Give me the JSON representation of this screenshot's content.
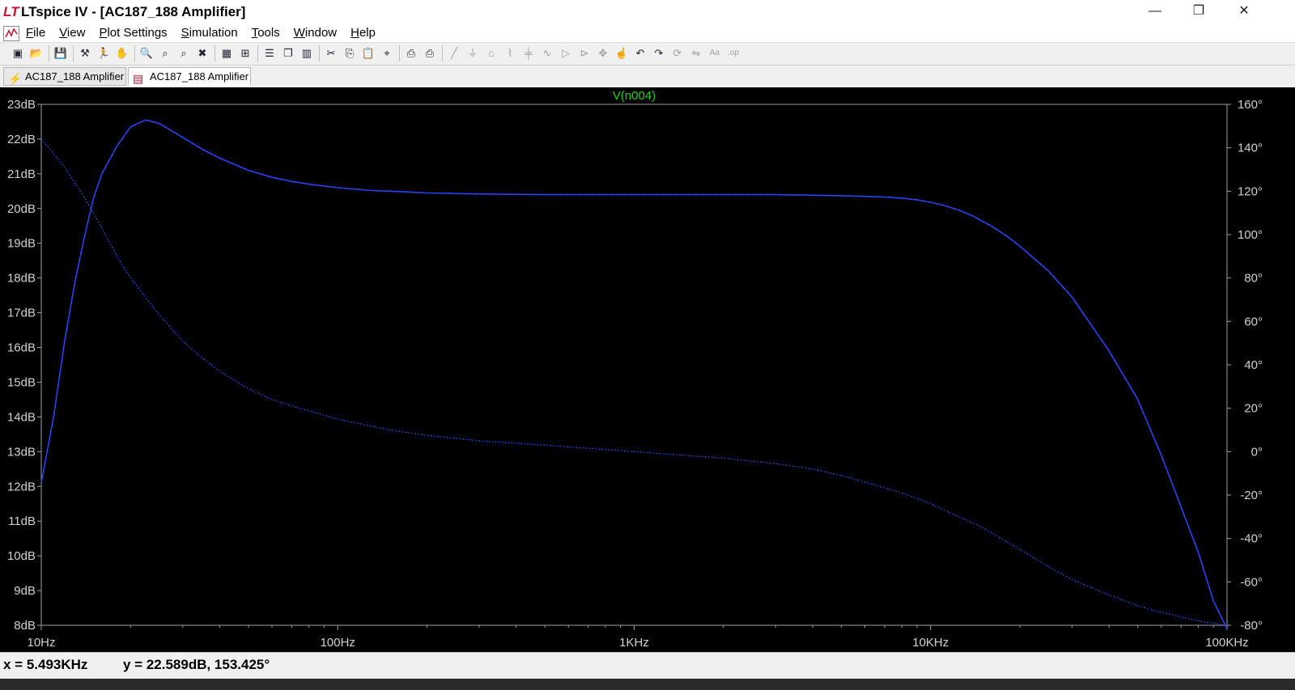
{
  "window": {
    "title": "LTspice IV - [AC187_188 Amplifier]",
    "logo_glyph": "LT",
    "minimize": "—",
    "restore": "❐",
    "close": "✕"
  },
  "menu": {
    "items": [
      {
        "label": "File",
        "u": "F",
        "rest": "ile"
      },
      {
        "label": "View",
        "u": "V",
        "rest": "iew"
      },
      {
        "label": "Plot Settings",
        "u": "P",
        "rest": "lot Settings"
      },
      {
        "label": "Simulation",
        "u": "S",
        "rest": "imulation"
      },
      {
        "label": "Tools",
        "u": "T",
        "rest": "ools"
      },
      {
        "label": "Window",
        "u": "W",
        "rest": "indow"
      },
      {
        "label": "Help",
        "u": "H",
        "rest": "elp"
      }
    ],
    "mdi_min": "_",
    "mdi_restore": "🗗",
    "mdi_close": "✕"
  },
  "toolbar": {
    "icons": [
      "new-schematic-icon",
      "open-icon",
      "save-icon",
      "control-panel-icon",
      "run-icon",
      "pan-hand-icon",
      "zoom-in-icon",
      "zoom-area-icon",
      "zoom-out-icon",
      "zoom-cancel-icon",
      "autorange-icon",
      "zoom-extents-icon",
      "tile-horizontal-icon",
      "cascade-icon",
      "tile-vertical-icon",
      "cut-icon",
      "copy-icon",
      "paste-icon",
      "find-icon",
      "print-preview-icon",
      "print-icon",
      "wire-icon",
      "ground-icon",
      "label-net-icon",
      "resistor-icon",
      "capacitor-icon",
      "inductor-icon",
      "diode-icon",
      "component-icon",
      "move-icon",
      "drag-icon",
      "undo-icon",
      "redo-icon",
      "rotate-icon",
      "mirror-icon",
      "text-icon",
      "spice-directive-icon"
    ]
  },
  "tabs": [
    {
      "label": "AC187_188 Amplifier",
      "kind": "schematic",
      "active": false
    },
    {
      "label": "AC187_188 Amplifier",
      "kind": "waveform",
      "active": true
    }
  ],
  "colors": {
    "plot_bg": "#000000",
    "grid": "#a0a0a0",
    "axis_text": "#d0d0d0",
    "trace_mag": "#2a3cff",
    "trace_phase": "#2a3cff",
    "trace_label": "#19d219"
  },
  "chart_data": {
    "type": "line",
    "trace_name": "V(n004)",
    "x_scale": "log",
    "xlim": [
      10,
      100000
    ],
    "x_ticks": [
      {
        "v": 10,
        "label": "10Hz"
      },
      {
        "v": 100,
        "label": "100Hz"
      },
      {
        "v": 1000,
        "label": "1KHz"
      },
      {
        "v": 10000,
        "label": "10KHz"
      },
      {
        "v": 100000,
        "label": "100KHz"
      }
    ],
    "ylim_left": [
      8,
      23
    ],
    "left_ticks": [
      "8dB",
      "9dB",
      "10dB",
      "11dB",
      "12dB",
      "13dB",
      "14dB",
      "15dB",
      "16dB",
      "17dB",
      "18dB",
      "19dB",
      "20dB",
      "21dB",
      "22dB",
      "23dB"
    ],
    "ylim_right": [
      -80,
      160
    ],
    "right_ticks": [
      "-80°",
      "-60°",
      "-40°",
      "-20°",
      "0°",
      "20°",
      "40°",
      "60°",
      "80°",
      "100°",
      "120°",
      "140°",
      "160°"
    ],
    "magnitude_db": {
      "x": [
        10,
        11,
        12,
        13,
        14,
        15,
        16,
        18,
        20,
        22.5,
        25,
        30,
        35,
        40,
        50,
        60,
        70,
        80,
        100,
        130,
        150,
        200,
        300,
        500,
        1000,
        2000,
        3000,
        5000,
        7000,
        8000,
        9000,
        10000,
        11000,
        12500,
        14000,
        16000,
        18000,
        20000,
        25000,
        30000,
        40000,
        50000,
        60000,
        70000,
        80000,
        90000,
        100000
      ],
      "y": [
        12.1,
        14.0,
        16.2,
        17.9,
        19.2,
        20.3,
        21.0,
        21.8,
        22.35,
        22.55,
        22.45,
        22.05,
        21.7,
        21.45,
        21.1,
        20.9,
        20.78,
        20.7,
        20.6,
        20.52,
        20.5,
        20.45,
        20.42,
        20.4,
        20.4,
        20.4,
        20.4,
        20.37,
        20.33,
        20.3,
        20.25,
        20.18,
        20.1,
        19.95,
        19.77,
        19.5,
        19.22,
        18.92,
        18.2,
        17.45,
        15.9,
        14.5,
        12.9,
        11.4,
        10.1,
        8.7,
        7.9
      ]
    },
    "phase_deg": {
      "x": [
        10,
        12,
        14,
        16,
        18,
        20,
        25,
        30,
        35,
        40,
        50,
        60,
        70,
        100,
        150,
        200,
        300,
        500,
        1000,
        2000,
        3000,
        4000,
        5000,
        6000,
        8000,
        10000,
        12000,
        15000,
        20000,
        25000,
        30000,
        40000,
        50000,
        60000,
        80000,
        100000
      ],
      "y": [
        144,
        131,
        117,
        103,
        90,
        80,
        63,
        51,
        43,
        37,
        29,
        24,
        21,
        15,
        10,
        7.5,
        5,
        3,
        0,
        -3,
        -5.5,
        -8,
        -11,
        -14,
        -19,
        -24,
        -29,
        -35,
        -45,
        -53,
        -59,
        -66,
        -71,
        -74,
        -78,
        -80
      ]
    }
  },
  "status": {
    "x_readout": "x = 5.493KHz",
    "y_readout": "y = 22.589dB, 153.425°"
  }
}
